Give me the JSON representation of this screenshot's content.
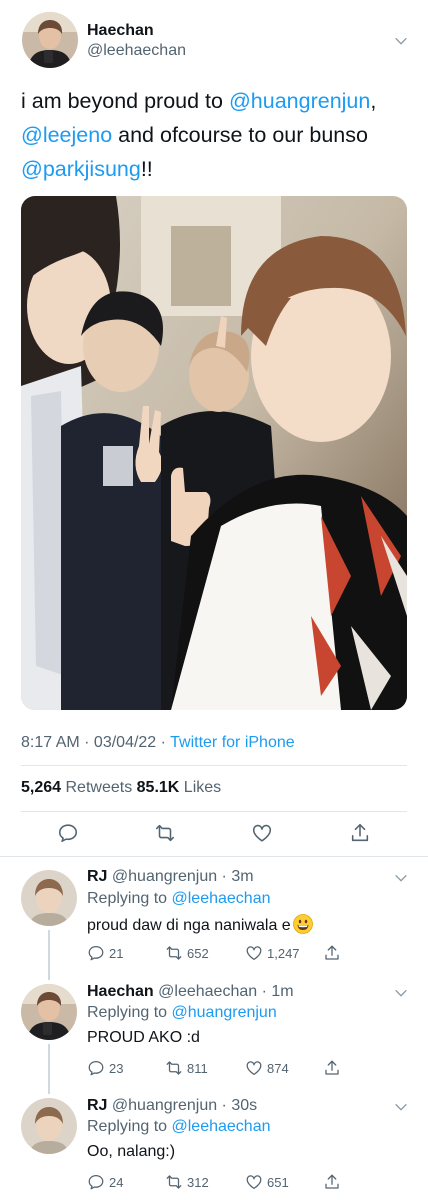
{
  "tweet": {
    "name": "Haechan",
    "handle": "@leehaechan",
    "text_line1_pre": "i am beyond proud to ",
    "text_line1_mention": "@huangrenjun",
    "text_line1_post": ",",
    "text_line2_mention": "@leejeno",
    "text_line2_post": " and ofcourse to our bunso",
    "text_line3_mention": "@parkjisung",
    "text_line3_post": "!!",
    "time": "8:17 AM · 03/04/22 · ",
    "source": "Twitter for iPhone",
    "retweets_count": "5,264",
    "retweets_label": " Retweets ",
    "likes_count": "85.1K",
    "likes_label": " Likes"
  },
  "replies": [
    {
      "name": "RJ",
      "handle": " @huangrenjun · 3m",
      "replying_label": "Replying to ",
      "replying_to": "@leehaechan",
      "text": "proud daw di nga naniwala e",
      "emoji": "grinning-face",
      "replies": "21",
      "retweets": "652",
      "likes": "1,247"
    },
    {
      "name": "Haechan",
      "handle": " @leehaechan · 1m",
      "replying_label": "Replying to ",
      "replying_to": "@huangrenjun",
      "text": "PROUD AKO :d",
      "replies": "23",
      "retweets": "811",
      "likes": "874"
    },
    {
      "name": "RJ",
      "handle": " @huangrenjun · 30s",
      "replying_label": "Replying to ",
      "replying_to": "@leehaechan",
      "text": "Oo, nalang:)",
      "replies": "24",
      "retweets": "312",
      "likes": "651"
    }
  ],
  "colors": {
    "accent": "#1d9bf0",
    "secondary_text": "#536471",
    "divider": "#e1e6ea"
  },
  "icons": [
    "chevron-down-icon",
    "reply-icon",
    "retweet-icon",
    "like-icon",
    "share-icon"
  ]
}
